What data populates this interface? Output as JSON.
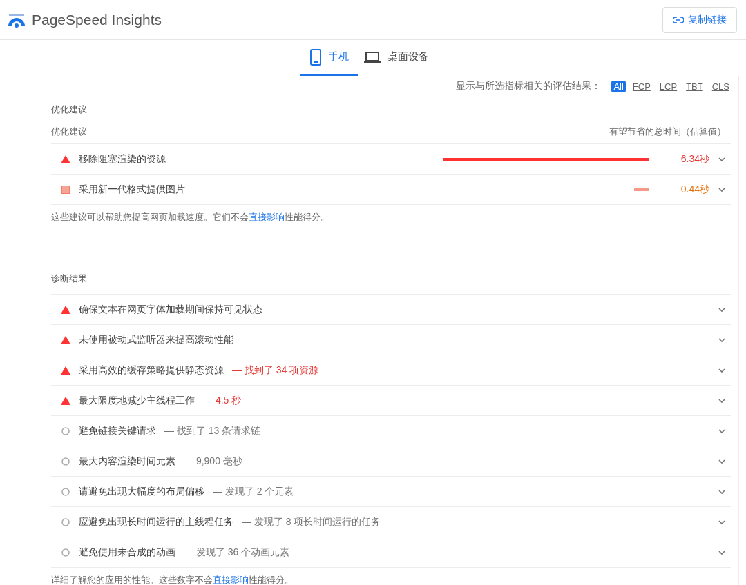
{
  "header": {
    "title": "PageSpeed Insights",
    "copy_button": "复制链接"
  },
  "tabs": [
    {
      "label": "手机",
      "kind": "phone",
      "selected": true
    },
    {
      "label": "桌面设备",
      "kind": "desktop",
      "selected": false
    }
  ],
  "filter": {
    "label": "显示与所选指标相关的评估结果：",
    "chips": [
      {
        "label": "All",
        "selected": true
      },
      {
        "label": "FCP",
        "selected": false
      },
      {
        "label": "LCP",
        "selected": false
      },
      {
        "label": "TBT",
        "selected": false
      },
      {
        "label": "CLS",
        "selected": false
      }
    ]
  },
  "opportunities": {
    "title": "优化建议",
    "column_1": "优化建议",
    "column_2": "有望节省的总时间（估算值）",
    "items": [
      {
        "kind": "fail",
        "title": "移除阻塞渲染的资源",
        "level": 1,
        "savings": "6.34秒"
      },
      {
        "kind": "average",
        "title": "采用新一代格式提供图片",
        "level": 0.07,
        "savings": "0.44秒"
      }
    ],
    "note": {
      "before": "这些建议可以帮助您提高网页加载速度。它们不会",
      "link": "直接影响",
      "after": "性能得分。"
    }
  },
  "diagnostics": {
    "title": "诊断结果",
    "items": [
      {
        "kind": "fail",
        "title": "确保文本在网页字体加载期间保持可见状态"
      },
      {
        "kind": "fail",
        "title": "未使用被动式监听器来提高滚动性能"
      },
      {
        "kind": "fail",
        "title": "采用高效的缓存策略提供静态资源",
        "detail": "— 找到了 34 项资源"
      },
      {
        "kind": "fail",
        "title": "最大限度地减少主线程工作",
        "detail": "— 4.5 秒"
      },
      {
        "kind": "info",
        "title": "避免链接关键请求",
        "detail": "— 找到了 13 条请求链"
      },
      {
        "kind": "info",
        "title": "最大内容渲染时间元素",
        "detail": "— 9,900 毫秒"
      },
      {
        "kind": "info",
        "title": "请避免出现大幅度的布局偏移",
        "detail": "— 发现了 2 个元素"
      },
      {
        "kind": "info",
        "title": "应避免出现长时间运行的主线程任务",
        "detail": "— 发现了 8 项长时间运行的任务"
      },
      {
        "kind": "info",
        "title": "避免使用未合成的动画",
        "detail": "— 发现了 36 个动画元素"
      }
    ],
    "note": {
      "before": "详细了解您的应用的性能。这些数字不会",
      "link": "直接影响",
      "after": "性能得分。"
    }
  }
}
